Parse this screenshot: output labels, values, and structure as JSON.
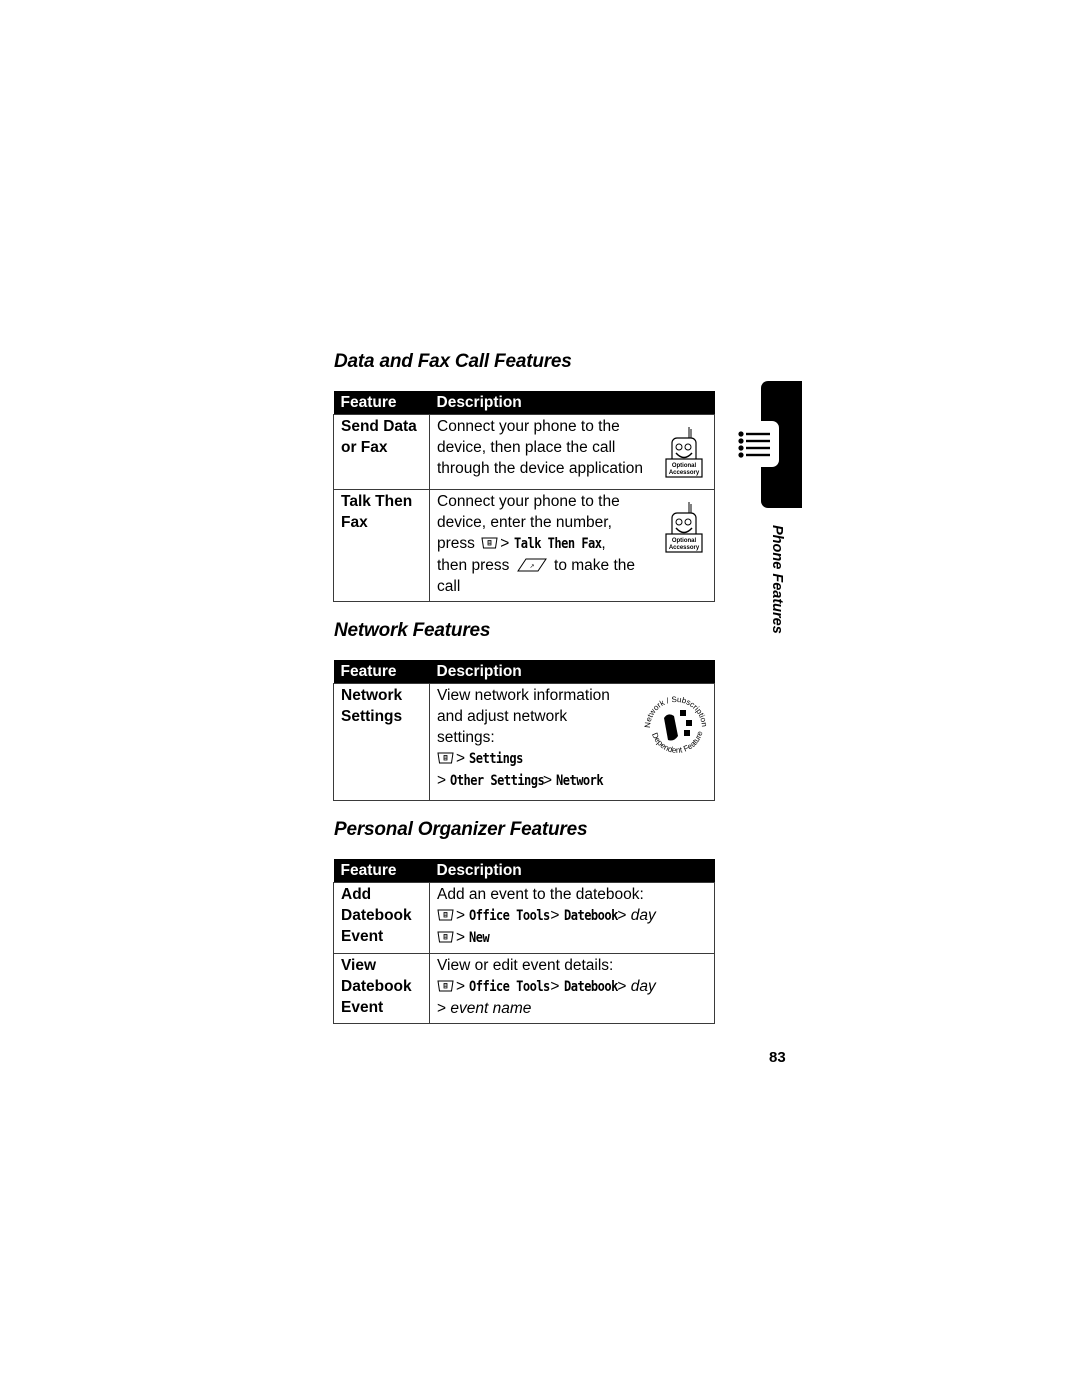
{
  "sections": [
    {
      "title": "Data and Fax Call Features",
      "headers": [
        "Feature",
        "Description"
      ],
      "rows": [
        {
          "feature": [
            "Send Data",
            "or Fax"
          ],
          "lines": [
            "Connect your phone to the",
            "device, then place the call",
            "through the device application"
          ],
          "badge": "optional-accessory-icon"
        },
        {
          "feature": [
            "Talk Then",
            "Fax"
          ],
          "lines": [
            "Connect your phone to the",
            "device, enter the number,"
          ],
          "press_prefix": "press",
          "menu_sep": ">",
          "menu_item": "Talk Then Fax",
          "menu_suffix": ",",
          "then_press": "then press",
          "to_make": "to make the",
          "last_line": "call",
          "badge": "optional-accessory-icon"
        }
      ]
    },
    {
      "title": "Network Features",
      "headers": [
        "Feature",
        "Description"
      ],
      "rows": [
        {
          "feature": [
            "Network",
            "Settings"
          ],
          "lines": [
            "View network information",
            "and adjust network",
            "settings:"
          ],
          "path1": [
            "Settings"
          ],
          "path2": [
            "Other Settings",
            "Network"
          ],
          "badge": "network-subscription-dependent-feature-icon",
          "badge_text_top": "Network / Subscription",
          "badge_text_bottom": "Dependent Feature"
        }
      ]
    },
    {
      "title": "Personal Organizer Features",
      "headers": [
        "Feature",
        "Description"
      ],
      "rows": [
        {
          "feature": [
            "Add",
            "Datebook",
            "Event"
          ],
          "intro": "Add an event to the datebook:",
          "path1": [
            "Office Tools",
            "Datebook"
          ],
          "path1_tail": "day",
          "path2": [
            "New"
          ]
        },
        {
          "feature": [
            "View",
            "Datebook",
            "Event"
          ],
          "intro": "View or edit event details:",
          "path1": [
            "Office Tools",
            "Datebook"
          ],
          "path1_tail": "day",
          "path2_italic": "event name"
        }
      ]
    }
  ],
  "sep": ">",
  "badge_labels": {
    "optional": "Optional",
    "accessory": "Accessory"
  },
  "side_tab": {
    "label": "Phone Features",
    "icon": "menu-list-icon"
  },
  "page_number": "83"
}
